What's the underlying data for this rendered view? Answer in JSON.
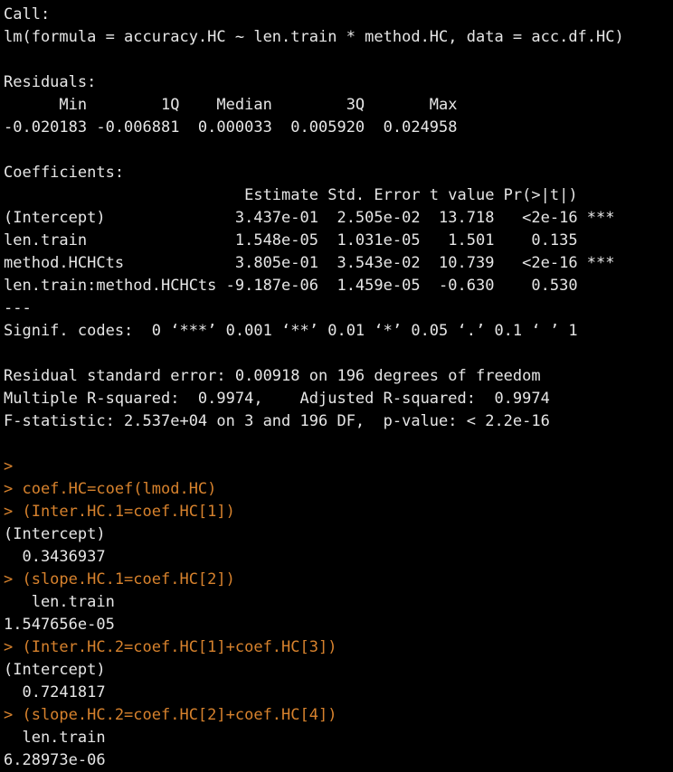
{
  "console": {
    "lines": [
      {
        "kind": "output",
        "text": "Call:"
      },
      {
        "kind": "output",
        "text": "lm(formula = accuracy.HC ~ len.train * method.HC, data = acc.df.HC)"
      },
      {
        "kind": "blank",
        "text": ""
      },
      {
        "kind": "output",
        "text": "Residuals:"
      },
      {
        "kind": "output",
        "text": "      Min        1Q    Median        3Q       Max "
      },
      {
        "kind": "output",
        "text": "-0.020183 -0.006881  0.000033  0.005920  0.024958 "
      },
      {
        "kind": "blank",
        "text": ""
      },
      {
        "kind": "output",
        "text": "Coefficients:"
      },
      {
        "kind": "output",
        "text": "                          Estimate Std. Error t value Pr(>|t|)    "
      },
      {
        "kind": "output",
        "text": "(Intercept)              3.437e-01  2.505e-02  13.718   <2e-16 ***"
      },
      {
        "kind": "output",
        "text": "len.train                1.548e-05  1.031e-05   1.501    0.135    "
      },
      {
        "kind": "output",
        "text": "method.HCHCts            3.805e-01  3.543e-02  10.739   <2e-16 ***"
      },
      {
        "kind": "output",
        "text": "len.train:method.HCHCts -9.187e-06  1.459e-05  -0.630    0.530    "
      },
      {
        "kind": "output",
        "text": "---"
      },
      {
        "kind": "output",
        "text": "Signif. codes:  0 ‘***’ 0.001 ‘**’ 0.01 ‘*’ 0.05 ‘.’ 0.1 ‘ ’ 1"
      },
      {
        "kind": "blank",
        "text": ""
      },
      {
        "kind": "output",
        "text": "Residual standard error: 0.00918 on 196 degrees of freedom"
      },
      {
        "kind": "output",
        "text": "Multiple R-squared:  0.9974,    Adjusted R-squared:  0.9974 "
      },
      {
        "kind": "output",
        "text": "F-statistic: 2.537e+04 on 3 and 196 DF,  p-value: < 2.2e-16"
      },
      {
        "kind": "blank",
        "text": ""
      },
      {
        "kind": "cmd",
        "text": ">"
      },
      {
        "kind": "cmd",
        "text": "> coef.HC=coef(lmod.HC)"
      },
      {
        "kind": "cmd",
        "text": "> (Inter.HC.1=coef.HC[1])"
      },
      {
        "kind": "output",
        "text": "(Intercept) "
      },
      {
        "kind": "output",
        "text": "  0.3436937 "
      },
      {
        "kind": "cmd",
        "text": "> (slope.HC.1=coef.HC[2])"
      },
      {
        "kind": "output",
        "text": "   len.train "
      },
      {
        "kind": "output",
        "text": "1.547656e-05 "
      },
      {
        "kind": "cmd",
        "text": "> (Inter.HC.2=coef.HC[1]+coef.HC[3])"
      },
      {
        "kind": "output",
        "text": "(Intercept) "
      },
      {
        "kind": "output",
        "text": "  0.7241817 "
      },
      {
        "kind": "cmd",
        "text": "> (slope.HC.2=coef.HC[2]+coef.HC[4])"
      },
      {
        "kind": "output",
        "text": "  len.train "
      },
      {
        "kind": "output",
        "text": "6.28973e-06 "
      }
    ]
  },
  "colors": {
    "background": "#000000",
    "output_text": "#e6e6e6",
    "command_text": "#d7822d"
  }
}
